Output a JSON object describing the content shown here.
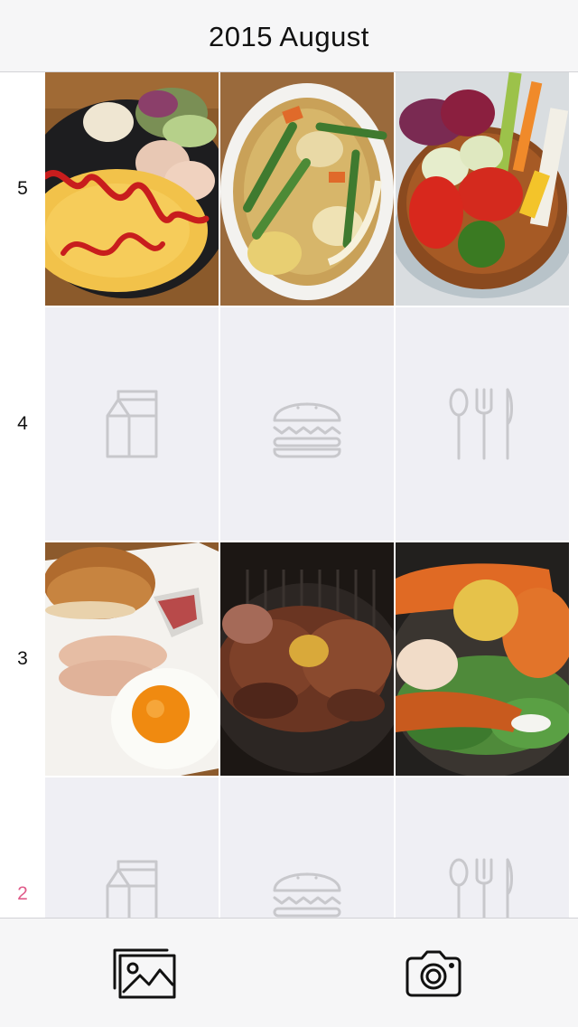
{
  "header": {
    "title": "2015 August"
  },
  "calendar": {
    "rows": [
      {
        "day": "5",
        "cells": [
          "omelette-plate-photo",
          "vegetable-soup-photo",
          "fresh-vegetables-photo"
        ]
      },
      {
        "day": "4",
        "cells": [
          "empty-breakfast-slot",
          "empty-lunch-slot",
          "empty-dinner-slot"
        ]
      },
      {
        "day": "3",
        "cells": [
          "bread-egg-ham-photo",
          "grilled-steak-photo",
          "grilled-chicken-photo"
        ]
      },
      {
        "day": "2",
        "today": true,
        "cells": [
          "empty-breakfast-slot",
          "empty-lunch-slot",
          "empty-dinner-slot"
        ]
      }
    ],
    "slot_icons": [
      "milk-carton-icon",
      "burger-icon",
      "cutlery-icon"
    ]
  },
  "tabbar": {
    "gallery_icon": "photo-library-icon",
    "camera_icon": "camera-icon"
  },
  "colors": {
    "today": "#e05c8a",
    "placeholder_bg": "#efeff4",
    "placeholder_icon": "#c8c8cc",
    "bar_bg": "#f6f6f7"
  }
}
